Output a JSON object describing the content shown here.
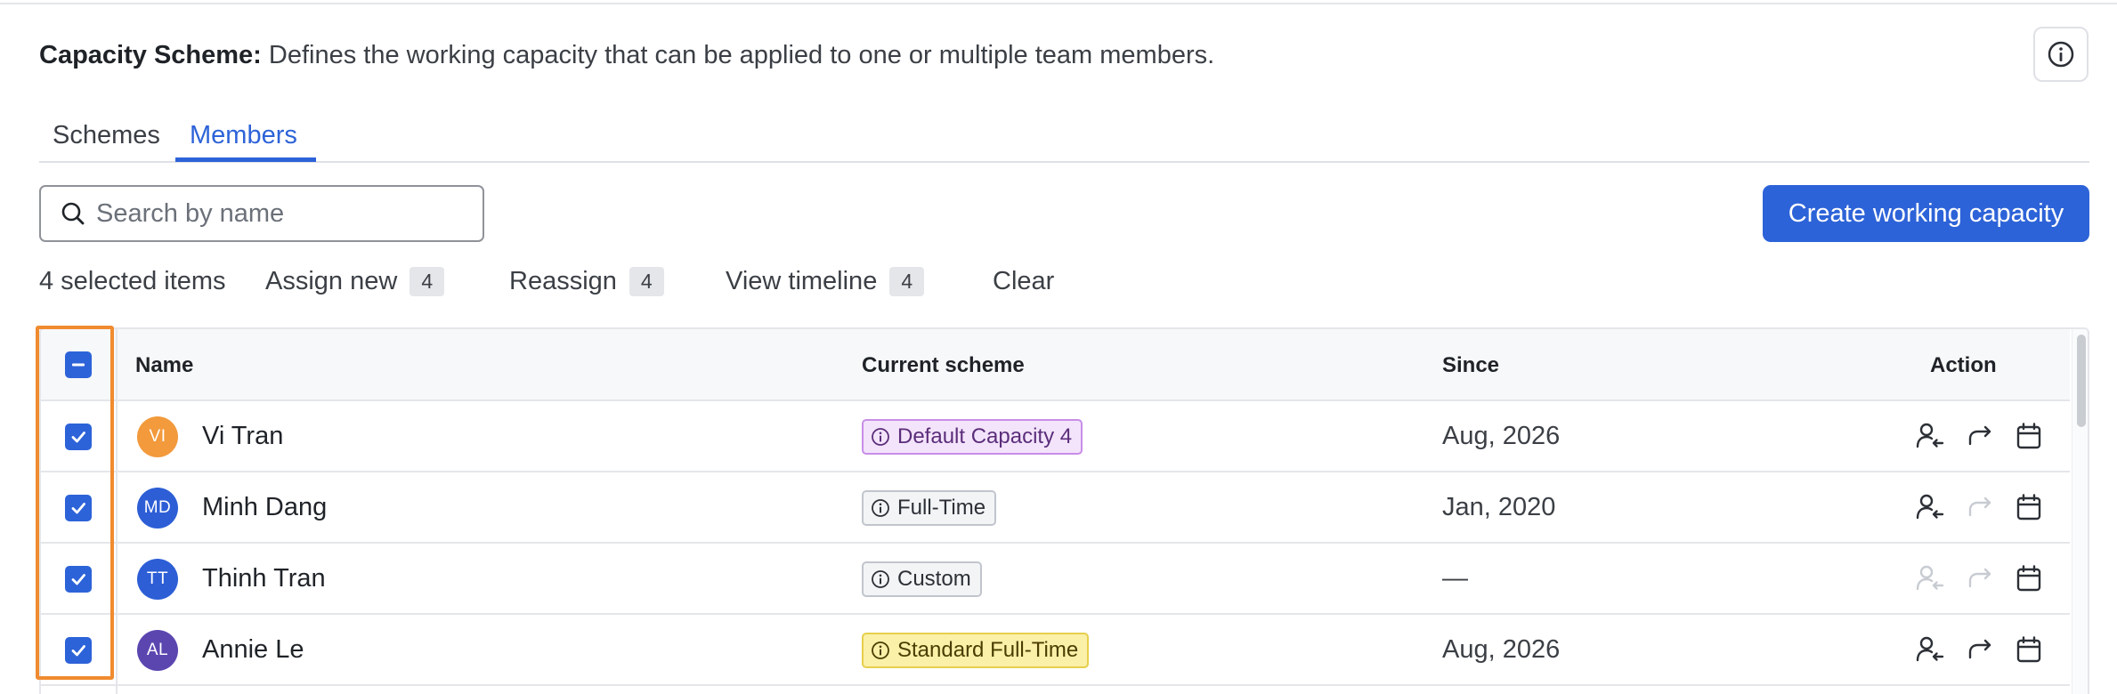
{
  "header": {
    "label": "Capacity Scheme:",
    "description": "Defines the working capacity that can be applied to one or multiple team members."
  },
  "tabs": [
    {
      "label": "Schemes",
      "active": false
    },
    {
      "label": "Members",
      "active": true
    }
  ],
  "search": {
    "placeholder": "Search by name",
    "value": ""
  },
  "create_button": {
    "label": "Create working capacity"
  },
  "bulk": {
    "selected_text": "4 selected items",
    "assign_label": "Assign new",
    "assign_count": "4",
    "reassign_label": "Reassign",
    "reassign_count": "4",
    "timeline_label": "View timeline",
    "timeline_count": "4",
    "clear_label": "Clear"
  },
  "table": {
    "columns": {
      "name": "Name",
      "scheme": "Current scheme",
      "since": "Since",
      "action": "Action"
    },
    "rows": [
      {
        "initials": "VI",
        "name": "Vi Tran",
        "avatar_color": "#f29a3c",
        "scheme": "Default Capacity 4",
        "scheme_style": "purple",
        "since": "Aug, 2026",
        "assign_enabled": true,
        "reassign_enabled": true,
        "selected": true
      },
      {
        "initials": "MD",
        "name": "Minh Dang",
        "avatar_color": "#2d5ed6",
        "scheme": "Full-Time",
        "scheme_style": "gray",
        "since": "Jan, 2020",
        "assign_enabled": true,
        "reassign_enabled": false,
        "selected": true
      },
      {
        "initials": "TT",
        "name": "Thinh Tran",
        "avatar_color": "#2d5ed6",
        "scheme": "Custom",
        "scheme_style": "gray",
        "since": "—",
        "assign_enabled": false,
        "reassign_enabled": false,
        "selected": true
      },
      {
        "initials": "AL",
        "name": "Annie Le",
        "avatar_color": "#5b46b0",
        "scheme": "Standard Full-Time",
        "scheme_style": "yellow",
        "since": "Aug, 2026",
        "assign_enabled": true,
        "reassign_enabled": true,
        "selected": true
      }
    ]
  },
  "colors": {
    "accent": "#2d63d8",
    "highlight": "#f08b2f",
    "tag_purple_bg": "#f3e4fb",
    "tag_purple_border": "#c88ee8",
    "tag_purple_text": "#5b2d7a",
    "tag_gray_bg": "#f3f4f6",
    "tag_gray_border": "#c1c5cc",
    "tag_gray_text": "#2c3036",
    "tag_yellow_bg": "#fbf0a8",
    "tag_yellow_border": "#e6cf4c",
    "tag_yellow_text": "#4a3d00"
  },
  "icons": {
    "info": "info-circle-icon",
    "search": "search-icon",
    "assign": "user-assign-icon",
    "reassign": "redo-arrow-icon",
    "timeline": "calendar-icon",
    "check": "check-icon",
    "indeterminate": "minus-icon"
  }
}
